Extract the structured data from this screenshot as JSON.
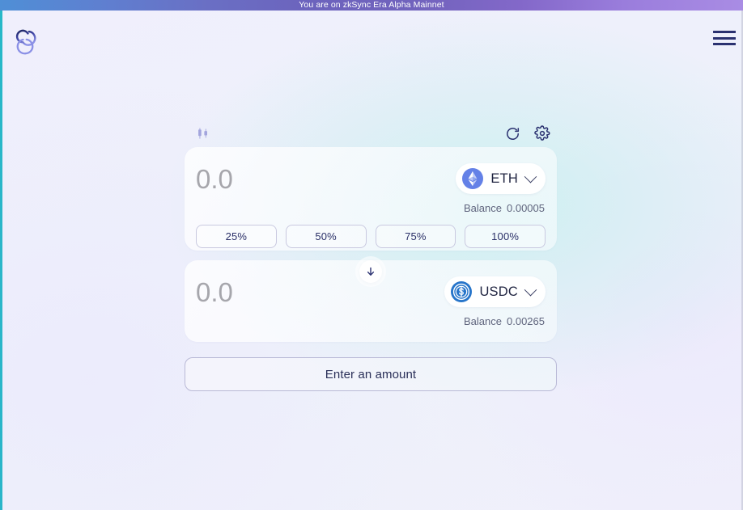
{
  "banner": {
    "text": "You are on zkSync Era Alpha Mainnet"
  },
  "header": {
    "logo_name": "zksync-logo",
    "menu_label": "Menu"
  },
  "toolbar": {
    "chart_icon_name": "candlestick-chart-icon",
    "refresh_icon_name": "refresh-icon",
    "settings_icon_name": "gear-icon"
  },
  "swap": {
    "from": {
      "amount_value": "",
      "amount_placeholder": "0.0",
      "token_symbol": "ETH",
      "token_icon_name": "ethereum-icon",
      "balance_label": "Balance",
      "balance_value": "0.00005",
      "percent_options": [
        "25%",
        "50%",
        "75%",
        "100%"
      ]
    },
    "to": {
      "amount_value": "",
      "amount_placeholder": "0.0",
      "token_symbol": "USDC",
      "token_icon_name": "usdc-icon",
      "balance_label": "Balance",
      "balance_value": "0.00265"
    },
    "direction_icon_name": "arrow-down-icon",
    "action_label": "Enter an amount"
  },
  "colors": {
    "banner_start": "#4f8fd6",
    "banner_end": "#a98ce4",
    "accent_navy": "#2a3170",
    "eth_blue": "#6481e7",
    "usdc_blue": "#2775ca",
    "left_edge_cyan": "#2bb6c9",
    "placeholder_gray": "#a6a6ac"
  }
}
